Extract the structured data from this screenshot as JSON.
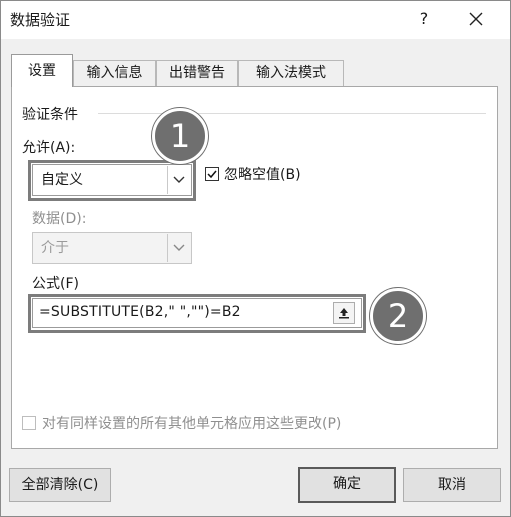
{
  "window": {
    "title": "数据验证",
    "help": "?"
  },
  "tabs": [
    "设置",
    "输入信息",
    "出错警告",
    "输入法模式"
  ],
  "settings": {
    "group_title": "验证条件",
    "allow_label": "允许(A):",
    "allow_value": "自定义",
    "ignore_blank_label": "忽略空值(B)",
    "ignore_blank_checked": true,
    "data_label": "数据(D):",
    "data_value": "介于",
    "formula_label": "公式(F)",
    "formula_value": "=SUBSTITUTE(B2,\" \",\"\")=B2",
    "apply_all_label": "对有同样设置的所有其他单元格应用这些更改(P)",
    "apply_all_checked": false
  },
  "annotations": {
    "badge1": "1",
    "badge2": "2"
  },
  "buttons": {
    "clear_all": "全部清除(C)",
    "ok": "确定",
    "cancel": "取消"
  },
  "icons": {
    "close": "close-icon",
    "dropdown": "chevron-down-icon",
    "collapse": "collapse-dialog-icon",
    "check": "checkmark-icon"
  }
}
